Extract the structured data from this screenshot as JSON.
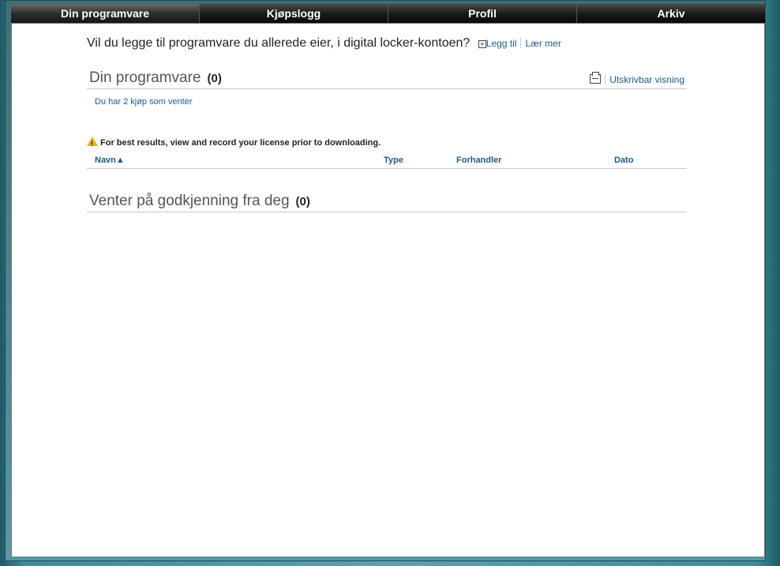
{
  "tabs": [
    {
      "label": "Din programvare",
      "active": true
    },
    {
      "label": "Kjøpslogg",
      "active": false
    },
    {
      "label": "Profil",
      "active": false
    },
    {
      "label": "Arkiv",
      "active": false
    }
  ],
  "intro": {
    "question": "Vil du legge til programvare du allerede eier, i digital locker-kontoen?",
    "add_link": "Legg til",
    "learn_link": "Lær mer"
  },
  "software_section": {
    "title": "Din programvare",
    "count": "(0)",
    "print_link": "Utskrivbar visning",
    "pending_link": "Du har 2 kjøp som venter"
  },
  "warning": {
    "text": "For best results, view and record your license prior to downloading."
  },
  "table": {
    "columns": [
      "Navn▲",
      "Type",
      "Forhandler",
      "Dato"
    ]
  },
  "approval_section": {
    "title": "Venter på godkjenning fra deg",
    "count": "(0)"
  },
  "colors": {
    "accent": "#1d5a8c",
    "tabbar": "#1b1b1b"
  }
}
